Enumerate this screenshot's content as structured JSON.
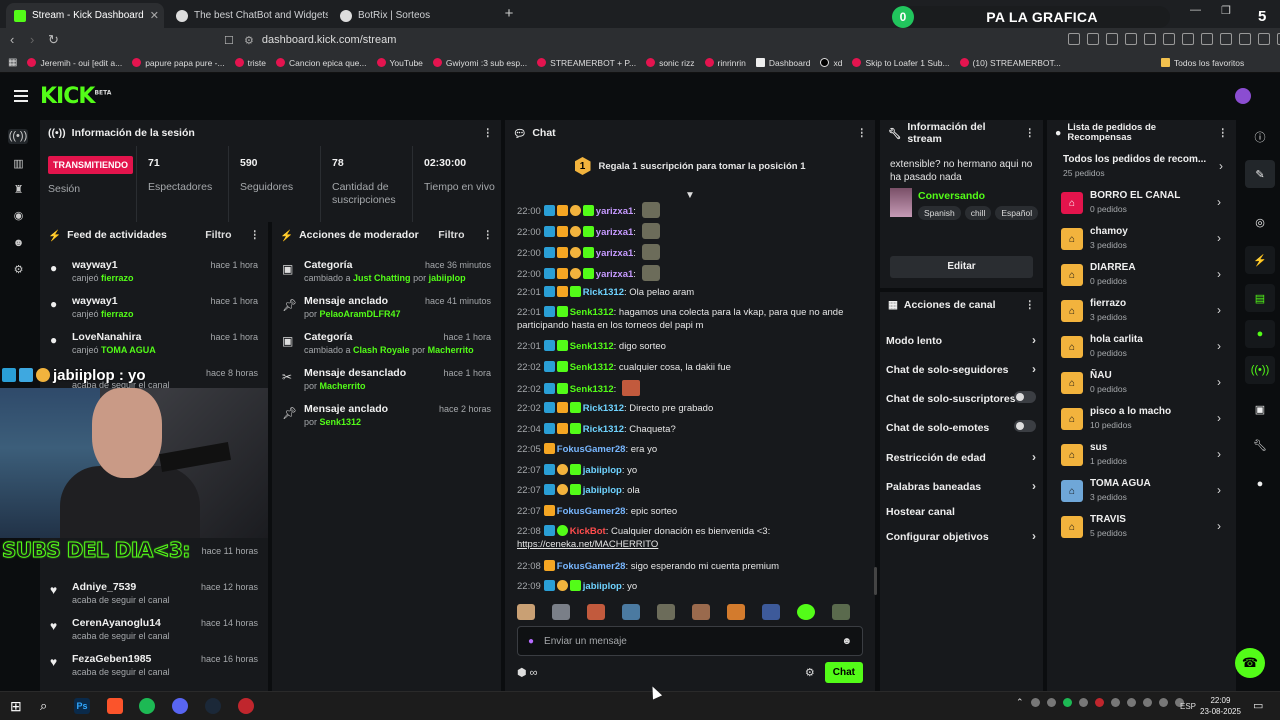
{
  "browser": {
    "tabs": [
      {
        "title": "Stream - Kick Dashboard",
        "active": true,
        "favicon_color": "#53fc18"
      },
      {
        "title": "The best ChatBot and Widgets for Ki",
        "active": false,
        "favicon_color": "#ffffff"
      },
      {
        "title": "BotRix | Sorteos",
        "active": false,
        "favicon_color": "#ffffff"
      }
    ],
    "promo": {
      "badge": "0",
      "text": "PA LA GRAFICA"
    },
    "counter": "5",
    "url": "dashboard.kick.com/stream",
    "bookmarks": [
      "Jeremih - oui [edit a...",
      "papure papa pure -...",
      "triste",
      "Cancion epica que...",
      "YouTube",
      "Gwiyomi :3 sub esp...",
      "STREAMERBOT + P...",
      "sonic rizz",
      "rinrinrin",
      "Dashboard",
      "xd",
      "Skip to Loafer 1 Sub...",
      "(10) STREAMERBOT...",
      "Todos los favoritos"
    ]
  },
  "kick": {
    "logo": "KICK",
    "logo_sup": "BETA",
    "accent": "#53fc18"
  },
  "session": {
    "title": "Información de la sesión",
    "live_badge": "TRANSMITIENDO",
    "live_label": "Sesión",
    "stats": [
      {
        "value": "71",
        "label": "Espectadores"
      },
      {
        "value": "590",
        "label": "Seguidores"
      },
      {
        "value": "78",
        "label": "Cantidad de suscripciones"
      },
      {
        "value": "02:30:00",
        "label": "Tiempo en vivo"
      }
    ]
  },
  "feed": {
    "title": "Feed de actividades",
    "filter": "Filtro",
    "items": [
      {
        "user": "wayway1",
        "action": "canjeó",
        "target": "fierrazo",
        "time": "hace 1 hora",
        "icon": "reward-icon"
      },
      {
        "user": "wayway1",
        "action": "canjeó",
        "target": "fierrazo",
        "time": "hace 1 hora",
        "icon": "reward-icon"
      },
      {
        "user": "LoveNanahira",
        "action": "canjeó",
        "target": "TOMA AGUA",
        "time": "hace 1 hora",
        "icon": "reward-icon"
      },
      {
        "user": "",
        "action": "acaba de seguir el canal",
        "target": "",
        "time": "hace 8 horas",
        "icon": "heart-icon"
      },
      {
        "user": "",
        "action": "",
        "target": "",
        "time": "hace 11 horas",
        "icon": "heart-icon"
      },
      {
        "user": "Adniye_7539",
        "action": "acaba de seguir el canal",
        "target": "",
        "time": "hace 12 horas",
        "icon": "heart-icon"
      },
      {
        "user": "CerenAyanoglu14",
        "action": "acaba de seguir el canal",
        "target": "",
        "time": "hace 14 horas",
        "icon": "heart-icon"
      },
      {
        "user": "FezaGeben1985",
        "action": "acaba de seguir el canal",
        "target": "",
        "time": "hace 16 horas",
        "icon": "heart-icon"
      }
    ]
  },
  "overlay": {
    "cam_user": "jabiiplop : yo",
    "subs_text": "SUBS DEL DIA<3:"
  },
  "modactions": {
    "title": "Acciones de moderador",
    "filter": "Filtro",
    "items": [
      {
        "title": "Categoría",
        "pre": "cambiado a",
        "hl1": "Just Chatting",
        "mid": "por",
        "hl2": "jabiiplop",
        "time": "hace 36 minutos",
        "icon": "category-icon"
      },
      {
        "title": "Mensaje anclado",
        "pre": "por",
        "hl1": "PelaoAramDLFR47",
        "mid": "",
        "hl2": "",
        "time": "hace 41 minutos",
        "icon": "pin-icon"
      },
      {
        "title": "Categoría",
        "pre": "cambiado a",
        "hl1": "Clash Royale",
        "mid": "por",
        "hl2": "Macherrito",
        "time": "hace 1 hora",
        "icon": "category-icon"
      },
      {
        "title": "Mensaje desanclado",
        "pre": "por",
        "hl1": "Macherrito",
        "mid": "",
        "hl2": "",
        "time": "hace 1 hora",
        "icon": "unpin-icon"
      },
      {
        "title": "Mensaje anclado",
        "pre": "por",
        "hl1": "Senk1312",
        "mid": "",
        "hl2": "",
        "time": "hace 2 horas",
        "icon": "pin-icon"
      }
    ]
  },
  "chat": {
    "title": "Chat",
    "pinned_num": "1",
    "pinned_text": "Regala 1 suscripción para tomar la posición 1",
    "messages": [
      {
        "time": "22:00",
        "user": "yarizxa1",
        "color": "purple",
        "text": "",
        "badges": [
          "mod",
          "crown",
          "sub",
          "vip"
        ],
        "emote": true
      },
      {
        "time": "22:00",
        "user": "yarizxa1",
        "color": "purple",
        "text": "",
        "badges": [
          "mod",
          "crown",
          "sub",
          "vip"
        ],
        "emote": true
      },
      {
        "time": "22:00",
        "user": "yarizxa1",
        "color": "purple",
        "text": "",
        "badges": [
          "mod",
          "crown",
          "sub",
          "vip"
        ],
        "emote": true
      },
      {
        "time": "22:00",
        "user": "yarizxa1",
        "color": "purple",
        "text": "",
        "badges": [
          "mod",
          "crown",
          "sub",
          "vip"
        ],
        "emote": true
      },
      {
        "time": "22:01",
        "user": "Rick1312",
        "color": "cyan",
        "text": "Ola pelao aram",
        "badges": [
          "mod",
          "crown",
          "vip"
        ]
      },
      {
        "time": "22:01",
        "user": "Senk1312",
        "color": "green",
        "text": "hagamos una colecta para la vkap, para que no ande participando hasta en los torneos del papi m",
        "badges": [
          "mod",
          "vip"
        ]
      },
      {
        "time": "22:01",
        "user": "Senk1312",
        "color": "green",
        "text": "digo sorteo",
        "badges": [
          "mod",
          "vip"
        ]
      },
      {
        "time": "22:02",
        "user": "Senk1312",
        "color": "green",
        "text": "cualquier cosa, la dakii fue",
        "badges": [
          "mod",
          "vip"
        ]
      },
      {
        "time": "22:02",
        "user": "Senk1312",
        "color": "green",
        "text": "",
        "badges": [
          "mod",
          "vip"
        ],
        "emote2": true
      },
      {
        "time": "22:02",
        "user": "Rick1312",
        "color": "cyan",
        "text": "Directo pre grabado",
        "badges": [
          "mod",
          "crown",
          "vip"
        ]
      },
      {
        "time": "22:04",
        "user": "Rick1312",
        "color": "cyan",
        "text": "Chaqueta?",
        "badges": [
          "mod",
          "crown",
          "vip"
        ]
      },
      {
        "time": "22:05",
        "user": "FokusGamer28",
        "color": "blue",
        "text": "era yo",
        "badges": [
          "crown"
        ]
      },
      {
        "time": "22:07",
        "user": "jabiiplop",
        "color": "cyan",
        "text": "yo",
        "badges": [
          "mod",
          "sub",
          "vip"
        ]
      },
      {
        "time": "22:07",
        "user": "jabiiplop",
        "color": "cyan",
        "text": "ola",
        "badges": [
          "mod",
          "sub",
          "vip"
        ]
      },
      {
        "time": "22:07",
        "user": "FokusGamer28",
        "color": "blue",
        "text": "epic sorteo",
        "badges": [
          "crown"
        ]
      },
      {
        "time": "22:08",
        "user": "KickBot",
        "color": "red",
        "text": "Cualquier donación es bienvenida <3:",
        "badges": [
          "mod",
          "bot"
        ],
        "link": "https://ceneka.net/MACHERRITO"
      },
      {
        "time": "22:08",
        "user": "FokusGamer28",
        "color": "blue",
        "text": "sigo esperando mi cuenta premium",
        "badges": [
          "crown"
        ]
      },
      {
        "time": "22:09",
        "user": "jabiiplop",
        "color": "cyan",
        "text": "yo",
        "badges": [
          "mod",
          "sub",
          "vip"
        ]
      }
    ],
    "input_placeholder": "Enviar un mensaje",
    "send_label": "Chat"
  },
  "streaminfo": {
    "title": "Información del stream",
    "stream_title": "extensible? no hermano aqui no ha pasado nada",
    "category": "Conversando",
    "tags": [
      "Spanish",
      "chill",
      "Español"
    ],
    "edit": "Editar"
  },
  "channelactions": {
    "title": "Acciones de canal",
    "items": [
      {
        "label": "Modo lento",
        "kind": "chevron"
      },
      {
        "label": "Chat de solo-seguidores",
        "kind": "chevron"
      },
      {
        "label": "Chat de solo-suscriptores",
        "kind": "toggle"
      },
      {
        "label": "Chat de solo-emotes",
        "kind": "toggle"
      },
      {
        "label": "Restricción de edad",
        "kind": "chevron"
      },
      {
        "label": "Palabras baneadas",
        "kind": "chevron"
      },
      {
        "label": "Hostear canal",
        "kind": "none"
      },
      {
        "label": "Configurar objetivos",
        "kind": "chevron"
      }
    ]
  },
  "rewards": {
    "title": "Lista de pedidos de Recompensas",
    "all_label": "Todos los pedidos de recom...",
    "all_count": "25 pedidos",
    "items": [
      {
        "name": "BORRO EL CANAL",
        "count": "0 pedidos",
        "style": "red"
      },
      {
        "name": "chamoy",
        "count": "3 pedidos",
        "style": "yellow"
      },
      {
        "name": "DIARREA",
        "count": "0 pedidos",
        "style": "yellow"
      },
      {
        "name": "fierrazo",
        "count": "3 pedidos",
        "style": "yellow"
      },
      {
        "name": "hola carlita",
        "count": "0 pedidos",
        "style": "yellow"
      },
      {
        "name": "ÑAU",
        "count": "0 pedidos",
        "style": "yellow"
      },
      {
        "name": "pisco a lo macho",
        "count": "10 pedidos",
        "style": "yellow"
      },
      {
        "name": "sus",
        "count": "1 pedidos",
        "style": "yellow"
      },
      {
        "name": "TOMA AGUA",
        "count": "3 pedidos",
        "style": "blue"
      },
      {
        "name": "TRAVIS",
        "count": "5 pedidos",
        "style": "yellow"
      }
    ]
  },
  "taskbar": {
    "lang": "ESP",
    "time": "22:09",
    "date": "23-08-2025"
  }
}
